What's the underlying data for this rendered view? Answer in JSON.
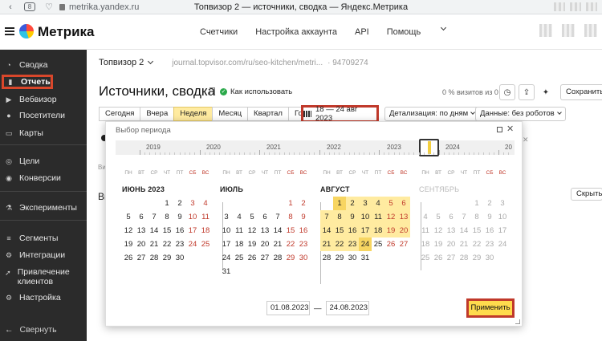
{
  "browser": {
    "tab_count": "8",
    "url": "metrika.yandex.ru",
    "page_title": "Топвизор 2 — источники, сводка — Яндекс.Метрика"
  },
  "header": {
    "logo_text": "Метрика",
    "nav": [
      "Счетчики",
      "Настройка аккаунта",
      "API",
      "Помощь"
    ]
  },
  "sidebar": {
    "items": [
      {
        "label": "Сводка",
        "icon": "dashboard-icon"
      },
      {
        "label": "Отчеты",
        "icon": "bar-chart-icon",
        "active": true
      },
      {
        "label": "Вебвизор",
        "icon": "play-icon"
      },
      {
        "label": "Посетители",
        "icon": "users-icon"
      },
      {
        "label": "Карты",
        "icon": "map-icon"
      },
      {
        "label": "Цели",
        "icon": "target-icon"
      },
      {
        "label": "Конверсии",
        "icon": "conversion-icon"
      },
      {
        "label": "Эксперименты",
        "icon": "experiment-icon"
      },
      {
        "label": "Сегменты",
        "icon": "segments-icon"
      },
      {
        "label": "Интеграции",
        "icon": "integrations-icon"
      },
      {
        "label": "Привлечение клиентов",
        "icon": "rocket-icon"
      },
      {
        "label": "Настройка",
        "icon": "gear-icon"
      }
    ],
    "collapse_label": "Свернуть"
  },
  "counter": {
    "name": "Топвизор 2",
    "url": "journal.topvisor.com/ru/seo-kitchen/metri...",
    "id": "· 94709274"
  },
  "page": {
    "title": "Источники, сводка",
    "in_use_label": "Как использовать",
    "visits_pct": "0 % визитов из 0",
    "save_label": "Сохранить отчет"
  },
  "period_tabs": [
    "Сегодня",
    "Вчера",
    "Неделя",
    "Месяц",
    "Квартал",
    "Год"
  ],
  "selected_period": "Неделя",
  "date_range": "18 — 24 авг 2023",
  "detail_select": "Детализация: по дням",
  "data_select": "Данные: без роботов",
  "background": {
    "vi_small": "Ви",
    "vi_big": "Ви",
    "collapse_all": "Скрыть"
  },
  "popup": {
    "title": "Выбор периода",
    "years": [
      "2019",
      "2020",
      "2021",
      "2022",
      "2023",
      "2024",
      "20"
    ],
    "weekdays": [
      "ПН",
      "ВТ",
      "СР",
      "ЧТ",
      "ПТ",
      "СБ",
      "ВС"
    ],
    "months": [
      {
        "name": "ИЮНЬ 2023",
        "offset": 3,
        "days": 30
      },
      {
        "name": "ИЮЛЬ",
        "offset": 5,
        "days": 31
      },
      {
        "name": "АВГУСТ",
        "offset": 1,
        "days": 31,
        "sel_from": 1,
        "sel_to": 24
      },
      {
        "name": "СЕНТЯБРЬ",
        "offset": 4,
        "days": 30,
        "dim": true
      }
    ],
    "date_from": "01.08.2023",
    "date_sep": "—",
    "date_to": "24.08.2023",
    "apply_label": "Применить"
  }
}
